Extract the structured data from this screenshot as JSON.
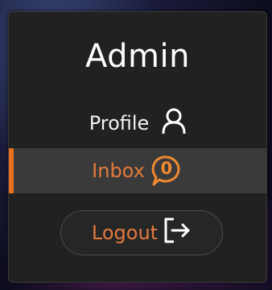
{
  "menu": {
    "title": "Admin",
    "items": [
      {
        "label": "Profile",
        "icon": "user-icon"
      },
      {
        "label": "Inbox",
        "icon": "chat-bubble-icon",
        "badge": "0",
        "active": true
      },
      {
        "label": "Logout",
        "icon": "logout-icon"
      }
    ]
  },
  "colors": {
    "accent": "#e8701f",
    "card_background": "#212121",
    "active_row_background": "#3a3a3a",
    "title": "#ffffff"
  }
}
